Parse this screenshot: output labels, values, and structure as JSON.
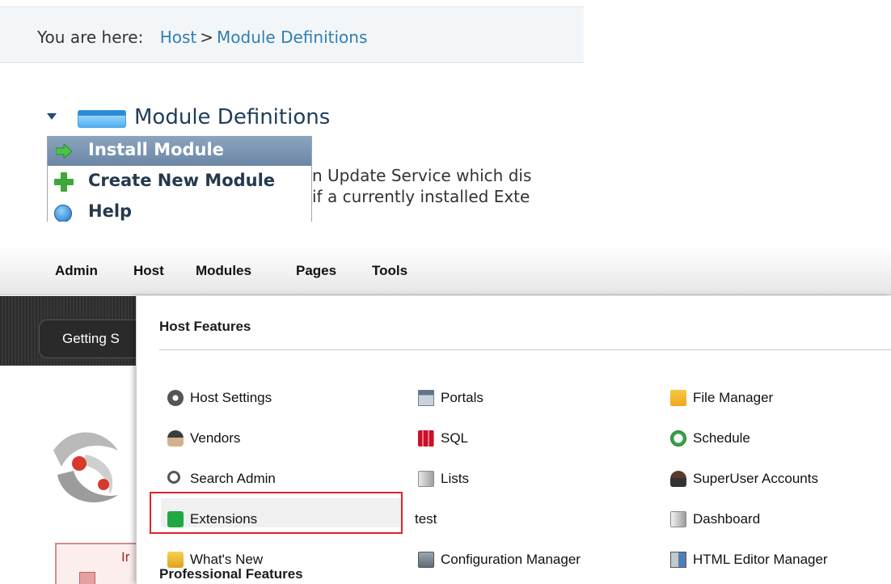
{
  "breadcrumb": {
    "lead": "You are here:",
    "items": [
      "Host",
      "Module Definitions"
    ],
    "separator": ">"
  },
  "module_header": {
    "title": "Module Definitions"
  },
  "action_menu": {
    "items": [
      {
        "label": "Install Module",
        "icon": "right-arrow-icon",
        "selected": true
      },
      {
        "label": "Create New Module",
        "icon": "plus-icon",
        "selected": false
      },
      {
        "label": "Help",
        "icon": "help-icon",
        "selected": false
      }
    ]
  },
  "body_text": {
    "line1": "n Update Service which dis",
    "line2": "if a currently installed Exte"
  },
  "control_bar": {
    "items": [
      "Admin",
      "Host",
      "Modules",
      "Pages",
      "Tools"
    ]
  },
  "page_tabs": {
    "getting_started": "Getting S"
  },
  "alert": {
    "text": "Ir"
  },
  "host_features": {
    "heading": "Host Features",
    "columns": [
      [
        {
          "label": "Host Settings",
          "icon": "gear-icon"
        },
        {
          "label": "Vendors",
          "icon": "vendors-icon"
        },
        {
          "label": "Search Admin",
          "icon": "search-icon"
        },
        {
          "label": "Extensions",
          "icon": "puzzle-icon",
          "highlighted": true
        },
        {
          "label": "What's New",
          "icon": "new-icon"
        }
      ],
      [
        {
          "label": "Portals",
          "icon": "portals-icon"
        },
        {
          "label": "SQL",
          "icon": "sql-icon"
        },
        {
          "label": "Lists",
          "icon": "lists-icon"
        },
        {
          "label": "test",
          "icon": ""
        },
        {
          "label": "Configuration Manager",
          "icon": "config-icon"
        }
      ],
      [
        {
          "label": "File Manager",
          "icon": "folder-icon"
        },
        {
          "label": "Schedule",
          "icon": "schedule-icon"
        },
        {
          "label": "SuperUser Accounts",
          "icon": "user-icon"
        },
        {
          "label": "Dashboard",
          "icon": "dashboard-icon"
        },
        {
          "label": "HTML Editor Manager",
          "icon": "html-editor-icon"
        }
      ]
    ]
  },
  "next_section": {
    "heading": "Professional Features"
  },
  "colors": {
    "highlight_border": "#e0242a",
    "link": "#2f7fb2",
    "menu_selected": "#7690ad"
  }
}
